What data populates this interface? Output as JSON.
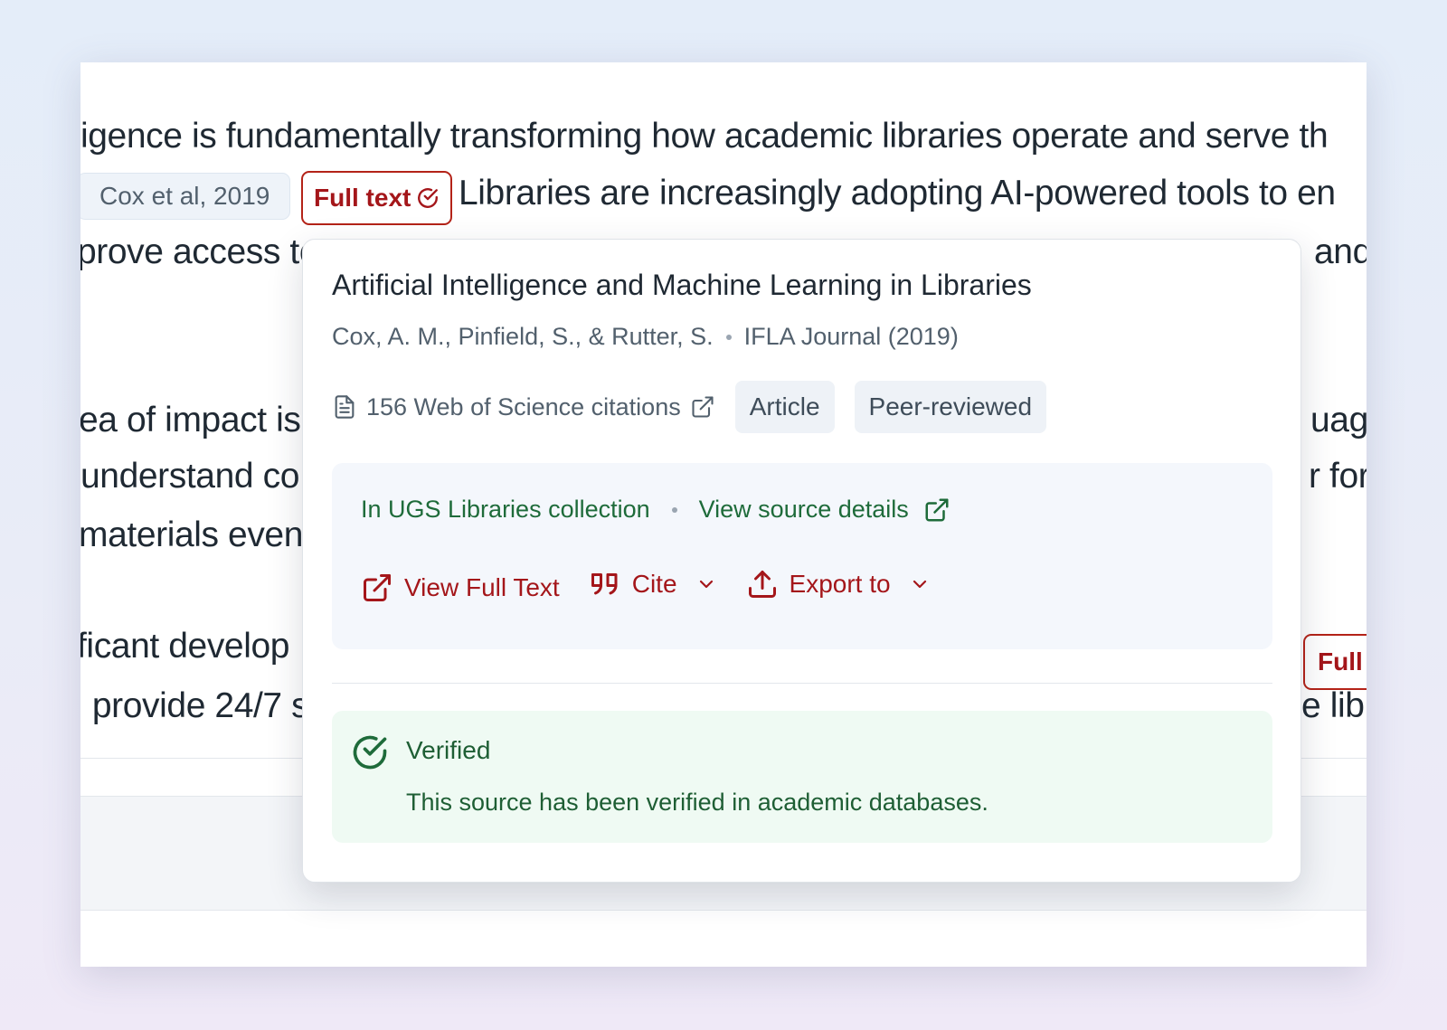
{
  "document": {
    "lines": [
      "igence is fundamentally transforming how academic libraries operate and serve th",
      "Libraries are increasingly adopting AI-powered tools to en",
      "prove access to",
      "and",
      "ea of impact is",
      "uage",
      "understand co",
      "r for",
      "materials even",
      "ficant develop",
      ". provide 24/7 s",
      "e lib"
    ],
    "citation_chip": "Cox et al, 2019",
    "fulltext_chip": "Full text",
    "fulltext_chip_partial": "Full t"
  },
  "popover": {
    "title": "Artificial Intelligence and Machine Learning in Libraries",
    "authors": "Cox, A. M., Pinfield, S., & Rutter, S.",
    "journal": "IFLA Journal (2019)",
    "citations": "156 Web of Science citations",
    "tags": [
      "Article",
      "Peer-reviewed"
    ],
    "library": {
      "collection": "In UGS Libraries collection",
      "details_link": "View source details"
    },
    "actions": {
      "view_full_text": "View Full Text",
      "cite": "Cite",
      "export": "Export to"
    },
    "verified": {
      "title": "Verified",
      "text": "This source has been verified in academic databases."
    }
  },
  "colors": {
    "accent_red": "#a4161a",
    "verified_green": "#1e6b3a",
    "verified_bg": "#effaf3"
  }
}
